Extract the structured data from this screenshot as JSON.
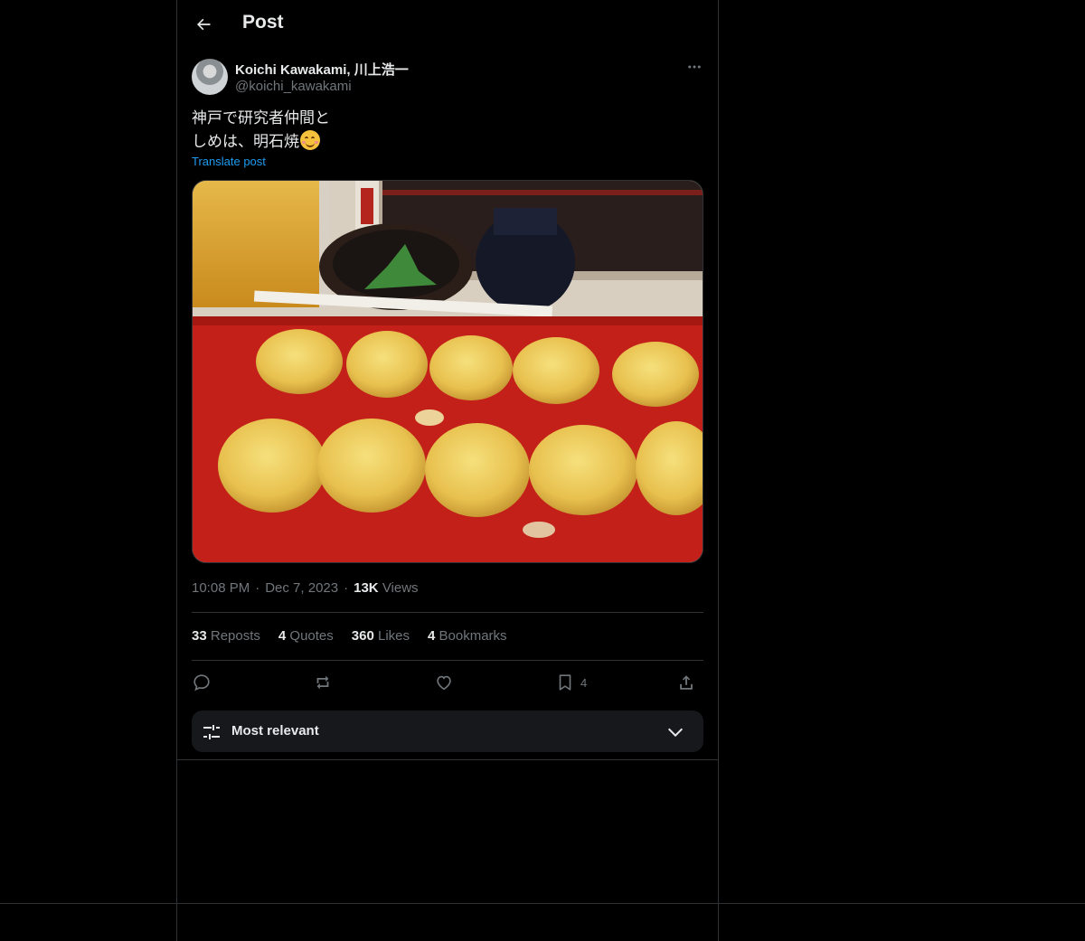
{
  "header": {
    "title": "Post"
  },
  "post": {
    "author_name": "Koichi Kawakami, 川上浩一",
    "author_handle": "@koichi_kawakami",
    "text_line1": "神戸で研究者仲間と",
    "text_line2": "しめは、明石焼",
    "emoji": "smiling-face-with-smiling-eyes",
    "translate_label": "Translate post",
    "time": "10:08 PM",
    "date": "Dec 7, 2023",
    "views_count": "13K",
    "views_label": "Views"
  },
  "stats": {
    "reposts_count": "33",
    "reposts_label": "Reposts",
    "quotes_count": "4",
    "quotes_label": "Quotes",
    "likes_count": "360",
    "likes_label": "Likes",
    "bookmarks_count": "4",
    "bookmarks_label": "Bookmarks"
  },
  "actions": {
    "bookmark_count": "4"
  },
  "sort": {
    "label": "Most relevant"
  },
  "colors": {
    "background": "#000000",
    "text": "#e7e9ea",
    "muted": "#71767b",
    "link": "#1d9bf0",
    "border": "#2f3336"
  }
}
